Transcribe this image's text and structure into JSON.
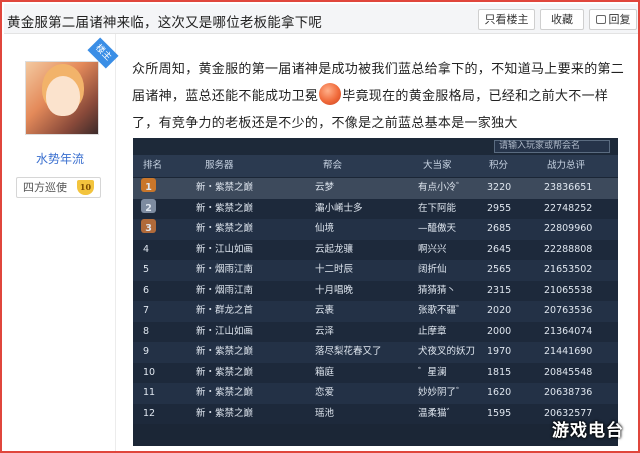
{
  "header": {
    "title": "黄金服第二届诸神来临，这次又是哪位老板能拿下呢",
    "only_op": "只看楼主",
    "collect": "收藏",
    "reply": "回复"
  },
  "author": {
    "username": "水势年流",
    "badge": "楼主",
    "rank_title": "四方巡使",
    "level": "10"
  },
  "post": {
    "text_before": "众所周知，黄金服的第一届诸神是成功被我们蓝总给拿下的，不知道马上要来的第二届诸神，蓝总还能不能成功卫冕",
    "text_after": "毕竟现在的黄金服格局，已经和之前大不一样了，有竞争力的老板还是不少的，不像是之前蓝总基本是一家独大"
  },
  "screenshot": {
    "search_placeholder": "请输入玩家或帮会名",
    "columns": [
      "排名",
      "服务器",
      "帮会",
      "大当家",
      "积分",
      "战力总评"
    ],
    "rows": [
      {
        "rank": "1",
        "server": "新・紫禁之巅",
        "guild": "云梦",
        "leader": "有点小冷゛",
        "score": "3220",
        "power": "23836651"
      },
      {
        "rank": "2",
        "server": "新・紫禁之巅",
        "guild": "灞小崤士多",
        "leader": "在下阿能",
        "score": "2955",
        "power": "22748252"
      },
      {
        "rank": "3",
        "server": "新・紫禁之巅",
        "guild": "仙境",
        "leader": "—醯傲天",
        "score": "2685",
        "power": "22809960"
      },
      {
        "rank": "4",
        "server": "新・江山如画",
        "guild": "云起龙骧",
        "leader": "啊兴兴",
        "score": "2645",
        "power": "22288808"
      },
      {
        "rank": "5",
        "server": "新・烟雨江南",
        "guild": "十二时辰",
        "leader": "阔折仙",
        "score": "2565",
        "power": "21653502"
      },
      {
        "rank": "6",
        "server": "新・烟雨江南",
        "guild": "十月唱晚",
        "leader": "猜猜猜丶",
        "score": "2315",
        "power": "21065538"
      },
      {
        "rank": "7",
        "server": "新・群龙之首",
        "guild": "云裹",
        "leader": "张歌不疆゛",
        "score": "2020",
        "power": "20763536"
      },
      {
        "rank": "8",
        "server": "新・江山如画",
        "guild": "云泽",
        "leader": "止摩章",
        "score": "2000",
        "power": "21364074"
      },
      {
        "rank": "9",
        "server": "新・紫禁之巅",
        "guild": "落尽梨花春又了",
        "leader": "犬夜叉的妖刀",
        "score": "1970",
        "power": "21441690"
      },
      {
        "rank": "10",
        "server": "新・紫禁之巅",
        "guild": "箱庭",
        "leader": "゛星澜",
        "score": "1815",
        "power": "20845548"
      },
      {
        "rank": "11",
        "server": "新・紫禁之巅",
        "guild": "恋爱",
        "leader": "妙妙阴了゛",
        "score": "1620",
        "power": "20638736"
      },
      {
        "rank": "12",
        "server": "新・紫禁之巅",
        "guild": "瑶池",
        "leader": "温柔猫゛",
        "score": "1595",
        "power": "20632577"
      }
    ]
  },
  "watermark": "游戏电台",
  "colors": {
    "frame_border": "#e0463c",
    "username": "#3a6fcf",
    "badge": "#3a8ee6",
    "table_bg": "#1b2636"
  }
}
